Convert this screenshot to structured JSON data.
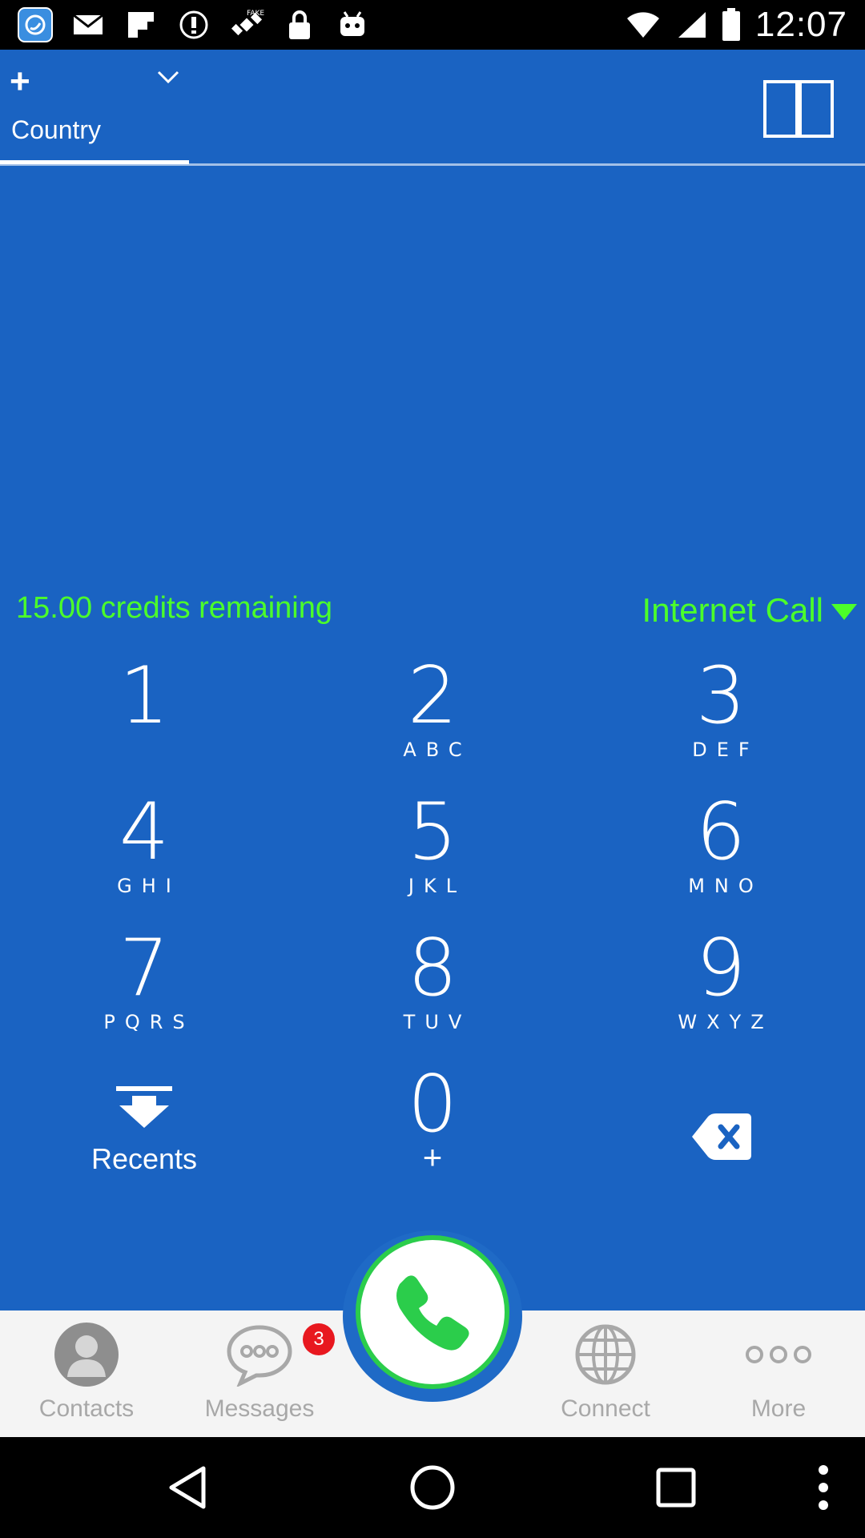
{
  "status_bar": {
    "time": "12:07",
    "icons": [
      "app-icon",
      "mail-icon",
      "flipboard-icon",
      "info-icon",
      "satellite-icon",
      "lock-icon",
      "android-icon"
    ],
    "right_icons": [
      "wifi-icon",
      "signal-icon",
      "battery-icon"
    ]
  },
  "header": {
    "plus": "+",
    "country_label": "Country",
    "book_icon": "book-icon"
  },
  "dialer": {
    "credits": "15.00 credits remaining",
    "call_mode": "Internet Call"
  },
  "keypad": {
    "keys": [
      {
        "digit": "1",
        "letters": ""
      },
      {
        "digit": "2",
        "letters": "ABC"
      },
      {
        "digit": "3",
        "letters": "DEF"
      },
      {
        "digit": "4",
        "letters": "GHI"
      },
      {
        "digit": "5",
        "letters": "JKL"
      },
      {
        "digit": "6",
        "letters": "MNO"
      },
      {
        "digit": "7",
        "letters": "PQRS"
      },
      {
        "digit": "8",
        "letters": "TUV"
      },
      {
        "digit": "9",
        "letters": "WXYZ"
      },
      {
        "digit": "0",
        "letters": "+"
      }
    ],
    "recents_label": "Recents"
  },
  "bottom_nav": {
    "items": [
      {
        "label": "Contacts",
        "icon": "person-icon"
      },
      {
        "label": "Messages",
        "icon": "chat-bubble-icon"
      },
      {
        "label": "Connect",
        "icon": "globe-icon"
      },
      {
        "label": "More",
        "icon": "more-dots-icon"
      }
    ],
    "messages_badge": "3",
    "call_icon": "phone-icon"
  },
  "colors": {
    "background": "#1a63c2",
    "accent_green": "#4cff2a",
    "call_ring": "#2bcd4b",
    "badge": "#e8181f"
  }
}
